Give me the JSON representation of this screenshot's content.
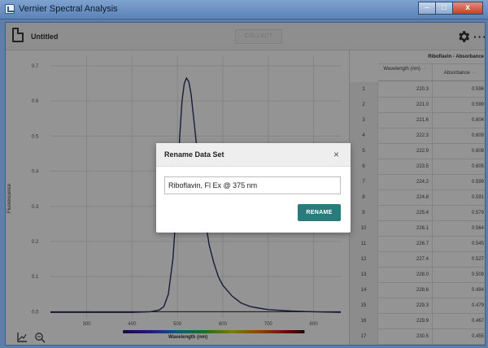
{
  "window": {
    "title": "Vernier Spectral Analysis",
    "buttons": [
      "–",
      "□",
      "x"
    ]
  },
  "toolbar": {
    "doc_title": "Untitled",
    "collect_label": "COLLECT",
    "more_label": "···"
  },
  "graph": {
    "y_axis_title": "Fluorescence",
    "x_axis_title": "Wavelength (nm)",
    "y_ticks": [
      "0.7",
      "0.6",
      "0.5",
      "0.4",
      "0.3",
      "0.2",
      "0.1",
      "0.0"
    ],
    "x_ticks": [
      "300",
      "400",
      "500",
      "600",
      "700",
      "800"
    ]
  },
  "chart_data": {
    "type": "line",
    "xlabel": "Wavelength (nm)",
    "ylabel": "Fluorescence",
    "xlim": [
      220,
      860
    ],
    "ylim": [
      -0.02,
      0.73
    ],
    "series": [
      {
        "name": "Riboflavin, Fl Ex @ 375 nm",
        "color": "#2d2e66",
        "x": [
          220,
          300,
          400,
          440,
          460,
          470,
          480,
          490,
          500,
          505,
          510,
          515,
          520,
          525,
          530,
          535,
          540,
          545,
          550,
          560,
          570,
          580,
          590,
          600,
          620,
          640,
          660,
          680,
          700,
          750,
          800,
          860
        ],
        "y": [
          -0.002,
          -0.002,
          -0.002,
          0.0,
          0.005,
          0.015,
          0.05,
          0.15,
          0.34,
          0.5,
          0.6,
          0.65,
          0.665,
          0.655,
          0.62,
          0.56,
          0.5,
          0.43,
          0.37,
          0.27,
          0.19,
          0.14,
          0.1,
          0.075,
          0.045,
          0.025,
          0.015,
          0.01,
          0.006,
          0.002,
          0.0,
          -0.002
        ]
      }
    ]
  },
  "table": {
    "title": "Riboflavin - Absorbance",
    "col1": "Wavelength (nm)",
    "col2": "Absorbance",
    "rows": [
      {
        "idx": "1",
        "wl": "220.3",
        "abs": "0.596"
      },
      {
        "idx": "2",
        "wl": "221.0",
        "abs": "0.599"
      },
      {
        "idx": "3",
        "wl": "221.6",
        "abs": "0.604"
      },
      {
        "idx": "4",
        "wl": "222.3",
        "abs": "0.609"
      },
      {
        "idx": "5",
        "wl": "222.9",
        "abs": "0.608"
      },
      {
        "idx": "6",
        "wl": "223.5",
        "abs": "0.605"
      },
      {
        "idx": "7",
        "wl": "224.2",
        "abs": "0.599"
      },
      {
        "idx": "8",
        "wl": "224.8",
        "abs": "0.591"
      },
      {
        "idx": "9",
        "wl": "225.4",
        "abs": "0.579"
      },
      {
        "idx": "10",
        "wl": "226.1",
        "abs": "0.564"
      },
      {
        "idx": "11",
        "wl": "226.7",
        "abs": "0.545"
      },
      {
        "idx": "12",
        "wl": "227.4",
        "abs": "0.527"
      },
      {
        "idx": "13",
        "wl": "228.0",
        "abs": "0.509"
      },
      {
        "idx": "14",
        "wl": "228.6",
        "abs": "0.494"
      },
      {
        "idx": "15",
        "wl": "229.3",
        "abs": "0.479"
      },
      {
        "idx": "16",
        "wl": "229.9",
        "abs": "0.467"
      },
      {
        "idx": "17",
        "wl": "230.5",
        "abs": "0.455"
      }
    ]
  },
  "dialog": {
    "title": "Rename Data Set",
    "close_label": "×",
    "input_value": "Riboflavin, Fl Ex @ 375 nm",
    "rename_label": "RENAME"
  }
}
